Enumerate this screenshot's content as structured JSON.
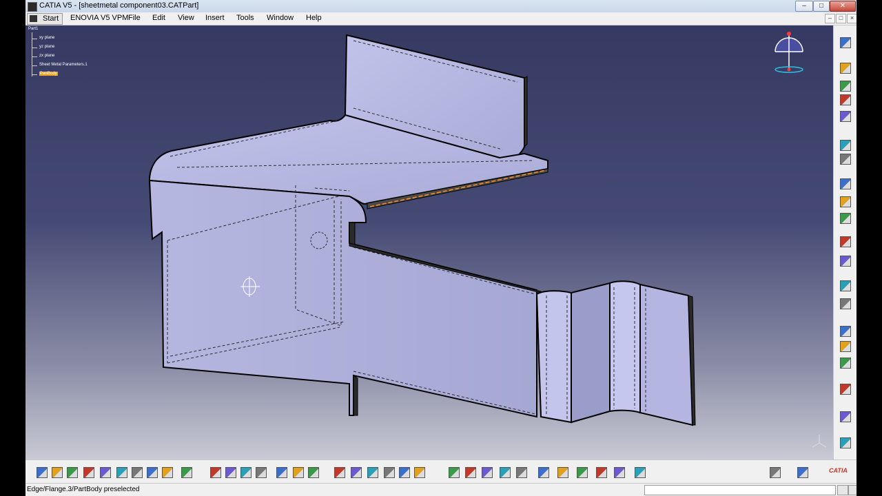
{
  "window": {
    "title": "CATIA V5 - [sheetmetal component03.CATPart]"
  },
  "menu": {
    "start": "Start",
    "enovia": "ENOVIA V5 VPM",
    "file": "File",
    "edit": "Edit",
    "view": "View",
    "insert": "Insert",
    "tools": "Tools",
    "window": "Window",
    "help": "Help"
  },
  "tree": {
    "root": "Part1",
    "items": [
      "xy plane",
      "yz plane",
      "zx plane",
      "Sheet Metal Parameters.1",
      "PartBody"
    ],
    "selected": "PartBody"
  },
  "status": {
    "text": "Edge/Flange.3/PartBody preselected"
  },
  "brand": {
    "logo": "CATIA"
  },
  "colors": {
    "viewport_top": "#363a62",
    "viewport_bottom": "#c9cad4",
    "part_face": "#b6b8e2",
    "preselect": "#ff8a1f"
  },
  "right_toolbar_icons": [
    "select-arrow-icon",
    "sheet-metal-parameters-icon",
    "wall-icon",
    "extrusion-icon",
    "flange-icon",
    "unfold-icon",
    "save-management-icon",
    "text-abc-icon",
    "annotation-icon",
    "sketch-icon",
    "sketcher-icon",
    "part-body-icon",
    "pattern-icon",
    "stamp-icon",
    "cutout-icon",
    "surface-icon",
    "hole-icon",
    "check-icon",
    "measure-icon",
    "apply-material-icon"
  ],
  "bottom_toolbar_icons": [
    "new-icon",
    "open-icon",
    "save-icon",
    "print-icon",
    "cut-icon",
    "copy-icon",
    "paste-icon",
    "undo-icon",
    "redo-icon",
    "whats-this-icon",
    "formula-icon",
    "knowledge-advisor-icon",
    "catalog-icon",
    "table-icon",
    "axis-icon",
    "publish-icon",
    "measure-icon",
    "fly-mode-icon",
    "fit-all-icon",
    "pan-icon",
    "rotate-icon",
    "zoom-in-icon",
    "zoom-out-icon",
    "normal-view-icon",
    "iso-view-icon",
    "shading-icon",
    "hide-show-icon",
    "swap-icon",
    "view-mode-icon",
    "material-icon",
    "lock-icon",
    "snapshot-icon",
    "select-set-icon",
    "render-icon",
    "camera-icon",
    "image-icon"
  ]
}
